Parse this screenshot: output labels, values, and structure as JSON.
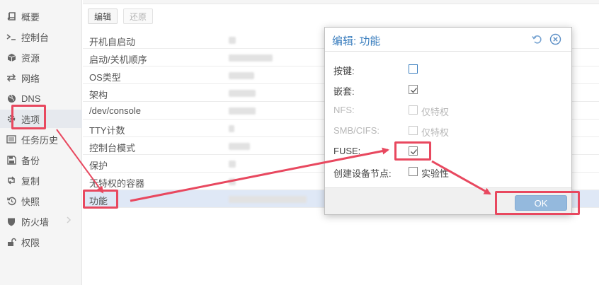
{
  "sidebar": {
    "items": [
      {
        "label": "概要",
        "icon": "book-icon"
      },
      {
        "label": "控制台",
        "icon": "terminal-icon"
      },
      {
        "label": "资源",
        "icon": "cube-icon"
      },
      {
        "label": "网络",
        "icon": "exchange-icon"
      },
      {
        "label": "DNS",
        "icon": "globe-icon"
      },
      {
        "label": "选项",
        "icon": "gear-icon"
      },
      {
        "label": "任务历史",
        "icon": "list-icon"
      },
      {
        "label": "备份",
        "icon": "floppy-icon"
      },
      {
        "label": "复制",
        "icon": "retweet-icon"
      },
      {
        "label": "快照",
        "icon": "history-icon"
      },
      {
        "label": "防火墙",
        "icon": "shield-icon"
      },
      {
        "label": "权限",
        "icon": "unlock-icon"
      }
    ],
    "active_index": 5
  },
  "toolbar": {
    "edit_label": "编辑",
    "revert_label": "还原"
  },
  "options": {
    "rows": [
      {
        "key": "开机自启动"
      },
      {
        "key": "启动/关机顺序"
      },
      {
        "key": "OS类型"
      },
      {
        "key": "架构"
      },
      {
        "key": "/dev/console"
      },
      {
        "key": "TTY计数"
      },
      {
        "key": "控制台模式"
      },
      {
        "key": "保护"
      },
      {
        "key": "无特权的容器"
      },
      {
        "key": "功能"
      }
    ],
    "selected_index": 9
  },
  "dialog": {
    "title": "编辑: 功能",
    "fields": [
      {
        "label": "按键:",
        "checked": false,
        "disabled": false,
        "option_text": ""
      },
      {
        "label": "嵌套:",
        "checked": true,
        "disabled": false,
        "option_text": ""
      },
      {
        "label": "NFS:",
        "checked": false,
        "disabled": true,
        "option_text": "仅特权"
      },
      {
        "label": "SMB/CIFS:",
        "checked": false,
        "disabled": true,
        "option_text": "仅特权"
      },
      {
        "label": "FUSE:",
        "checked": true,
        "disabled": false,
        "option_text": ""
      },
      {
        "label": "创建设备节点:",
        "checked": false,
        "disabled": false,
        "option_text": "实验性"
      }
    ],
    "ok_label": "OK",
    "header_icons": [
      "reset-icon",
      "close-icon"
    ]
  },
  "colors": {
    "annotation": "#e8485f",
    "accent": "#3c7fbf",
    "ok_button": "#94b9dd"
  }
}
